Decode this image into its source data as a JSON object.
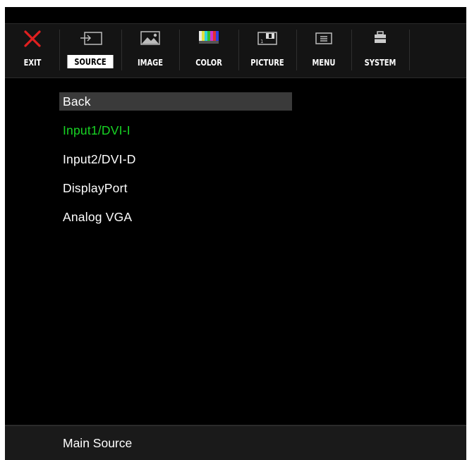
{
  "toolbar": {
    "items": [
      {
        "label": "EXIT",
        "icon": "close-icon"
      },
      {
        "label": "SOURCE",
        "icon": "input-source-icon"
      },
      {
        "label": "IMAGE",
        "icon": "image-icon"
      },
      {
        "label": "COLOR",
        "icon": "color-bars-icon"
      },
      {
        "label": "PICTURE",
        "icon": "picture-in-picture-icon"
      },
      {
        "label": "MENU",
        "icon": "menu-icon"
      },
      {
        "label": "SYSTEM",
        "icon": "system-icon"
      }
    ],
    "active": "SOURCE"
  },
  "menu": {
    "items": [
      "Back",
      "Input1/DVI-I",
      "Input2/DVI-D",
      "DisplayPort",
      "Analog VGA"
    ],
    "highlighted": "Back",
    "current_source": "Input1/DVI-I"
  },
  "status": {
    "text": "Main Source"
  },
  "colors": {
    "background": "#000000",
    "exit_icon": "#e02020",
    "current_source": "#18d424",
    "highlight_bar": "#3a3a3a"
  }
}
